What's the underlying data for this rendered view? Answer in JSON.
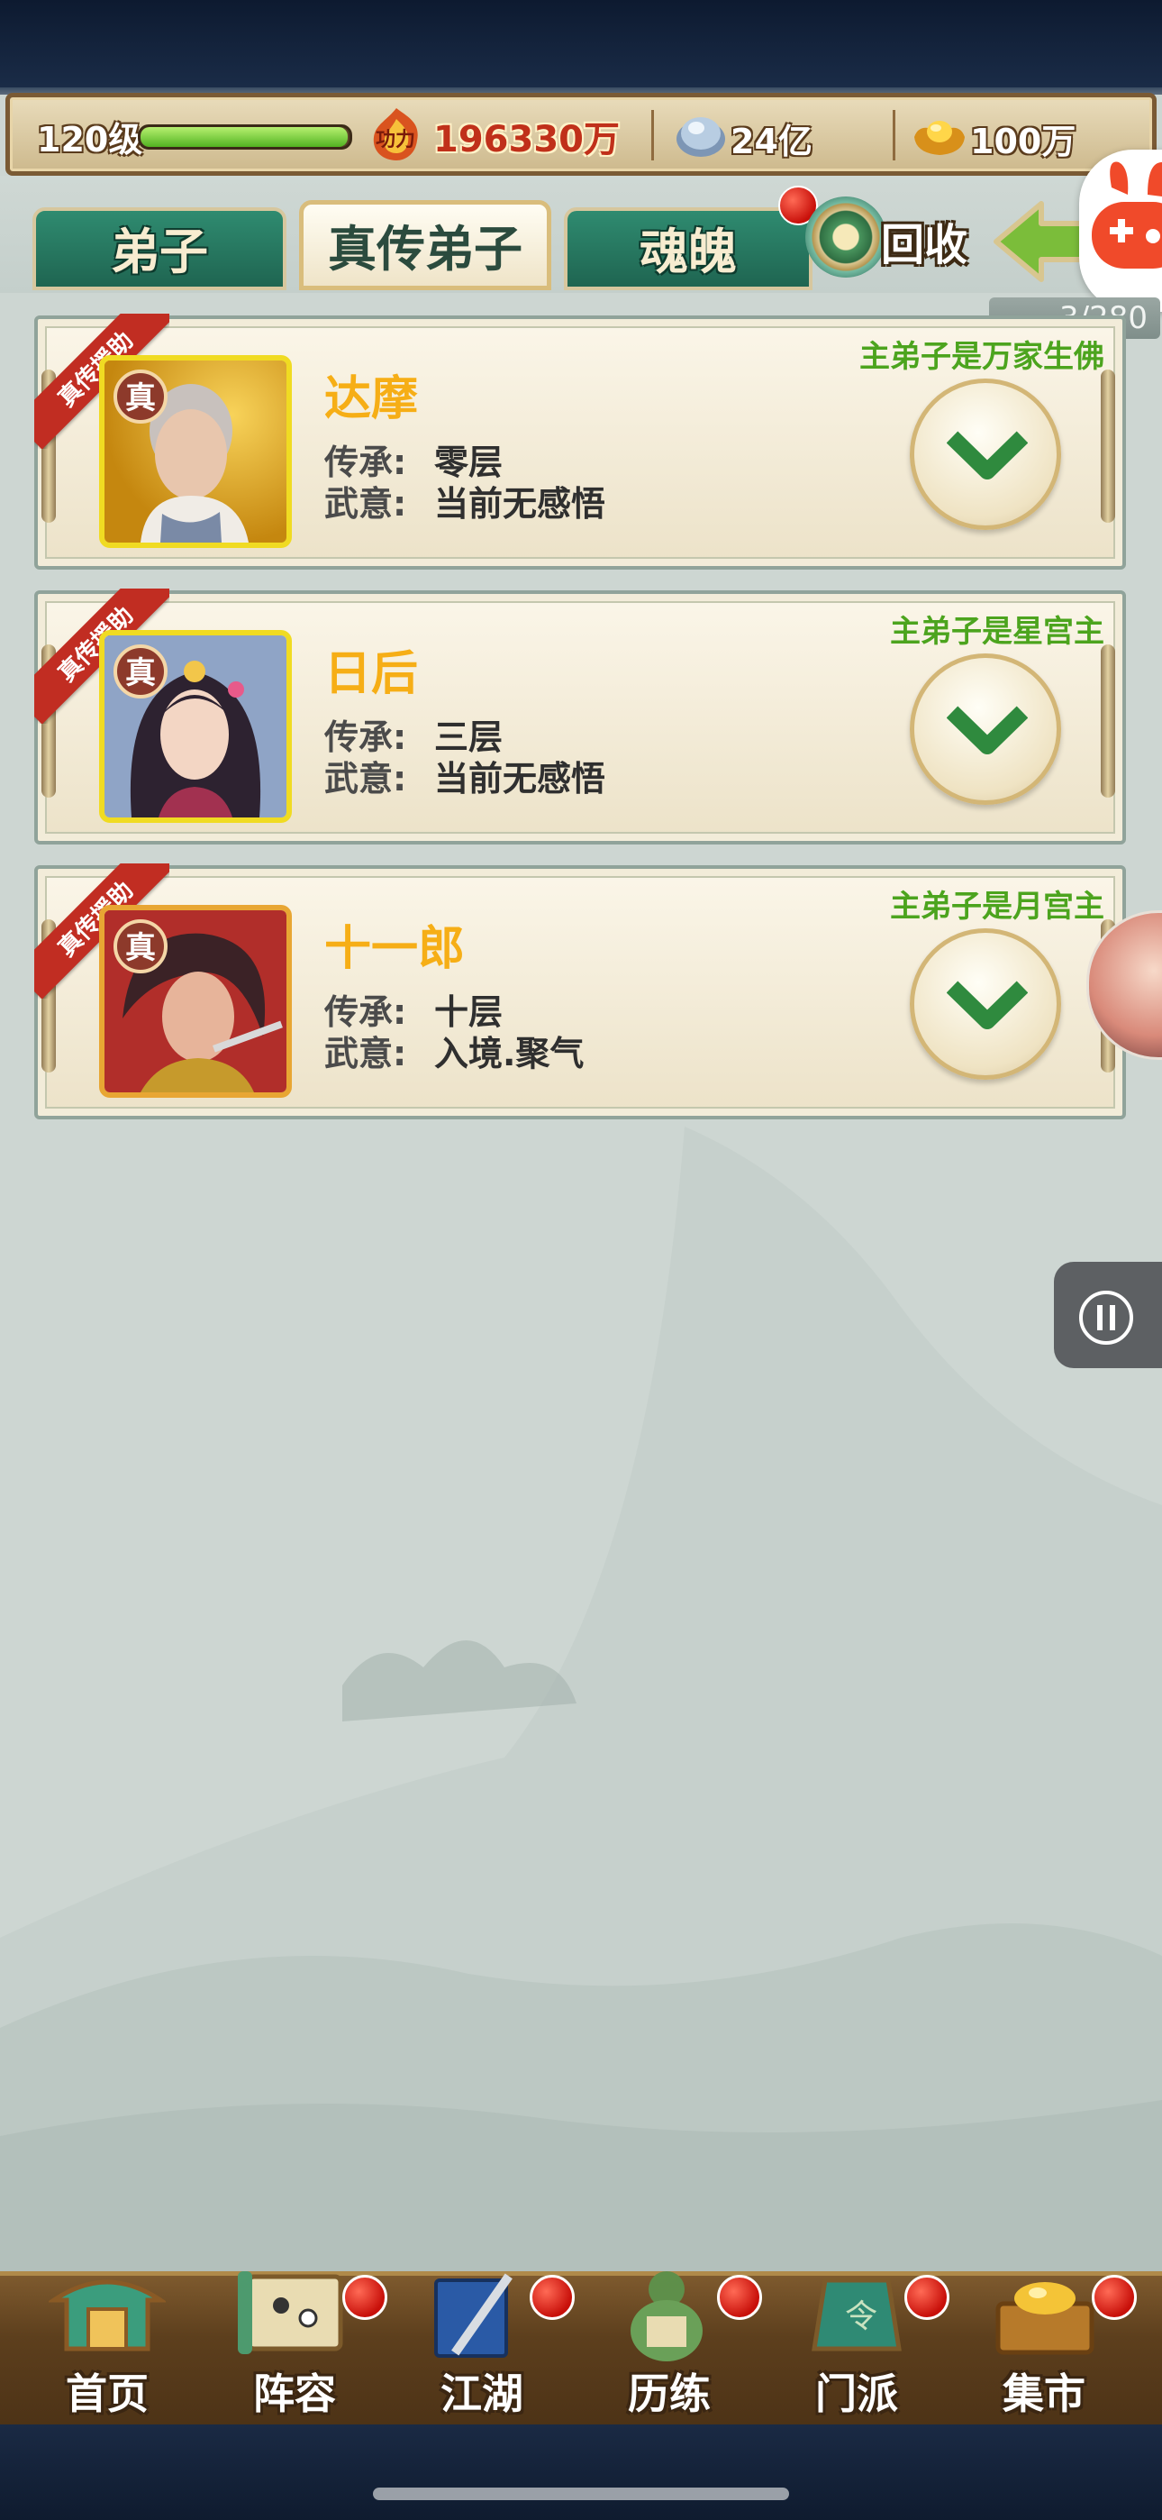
{
  "resources": {
    "level": "120级",
    "level_progress": 0.99,
    "power_label_icon": "gongli-emblem-icon",
    "power": "196330万",
    "silver": "24亿",
    "gold": "100万"
  },
  "tabs": [
    {
      "label": "弟子",
      "active": false
    },
    {
      "label": "真传弟子",
      "active": true
    },
    {
      "label": "魂魄",
      "active": false,
      "badge": true
    }
  ],
  "actions": {
    "recycle_label": "回收",
    "back_label": "返"
  },
  "count": "3/280",
  "disciples": [
    {
      "ribbon": "真传援助",
      "badge": "真",
      "name": "达摩",
      "inherit_label": "传承:",
      "inherit_value": "零层",
      "intent_label": "武意:",
      "intent_value": "当前无感悟",
      "master": "主弟子是万家生佛"
    },
    {
      "ribbon": "真传援助",
      "badge": "真",
      "name": "日后",
      "inherit_label": "传承:",
      "inherit_value": "三层",
      "intent_label": "武意:",
      "intent_value": "当前无感悟",
      "master": "主弟子是星宫主"
    },
    {
      "ribbon": "真传援助",
      "badge": "真",
      "name": "十一郎",
      "inherit_label": "传承:",
      "inherit_value": "十层",
      "intent_label": "武意:",
      "intent_value": "入境.聚气",
      "master": "主弟子是月宫主"
    }
  ],
  "nav": [
    {
      "label": "首页",
      "icon": "gate-icon",
      "badge": false
    },
    {
      "label": "阵容",
      "icon": "scroll-board-icon",
      "badge": true
    },
    {
      "label": "江湖",
      "icon": "book-sword-icon",
      "badge": true
    },
    {
      "label": "历练",
      "icon": "gourd-icon",
      "badge": true
    },
    {
      "label": "门派",
      "icon": "token-icon",
      "badge": true
    },
    {
      "label": "集市",
      "icon": "treasure-icon",
      "badge": true
    }
  ],
  "colors": {
    "accent_gold": "#f6ae16",
    "master_green": "#4ca41e",
    "tab_green": "#2f8b70",
    "ribbon_red": "#c12d22"
  }
}
